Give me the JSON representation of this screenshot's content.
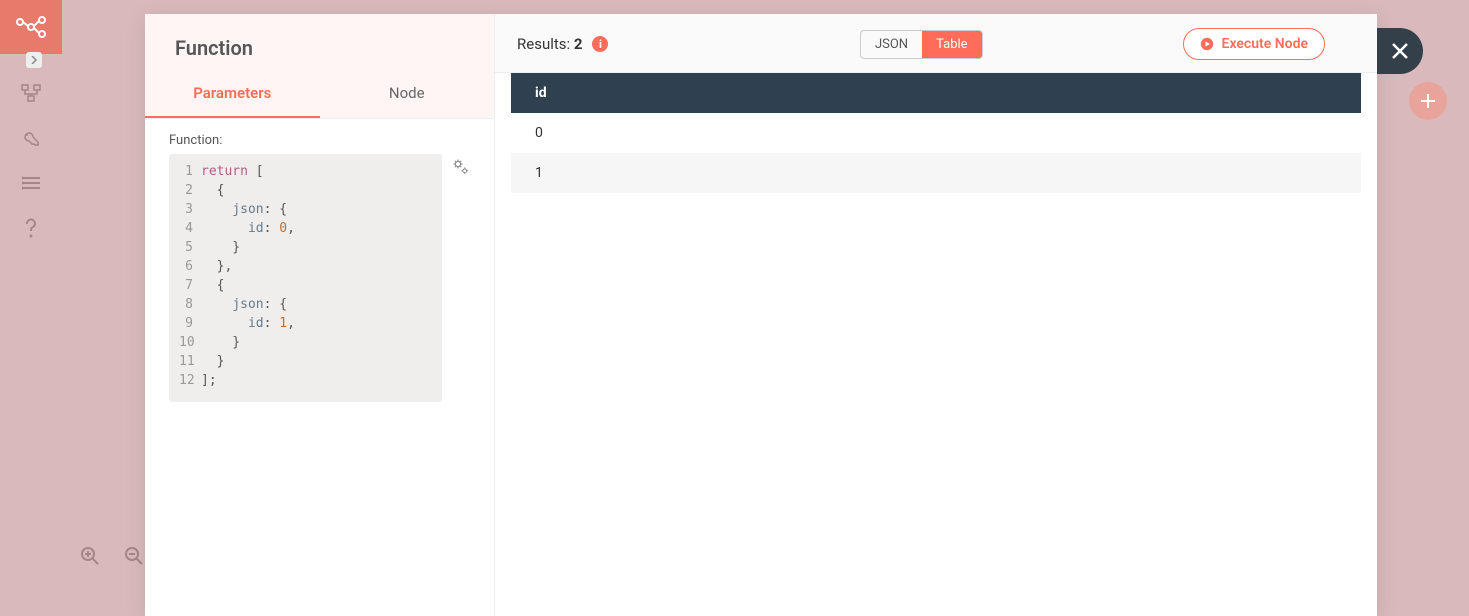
{
  "node_title": "Function",
  "tabs": {
    "parameters": "Parameters",
    "node": "Node",
    "active": "parameters"
  },
  "field_label": "Function:",
  "code": {
    "lines": [
      {
        "n": "1",
        "tokens": [
          {
            "t": "return",
            "c": "key"
          },
          {
            "t": " [",
            "c": "punc"
          }
        ]
      },
      {
        "n": "2",
        "tokens": [
          {
            "t": "  {",
            "c": "punc"
          }
        ]
      },
      {
        "n": "3",
        "tokens": [
          {
            "t": "    ",
            "c": "punc"
          },
          {
            "t": "json",
            "c": "prop"
          },
          {
            "t": ": {",
            "c": "punc"
          }
        ]
      },
      {
        "n": "4",
        "tokens": [
          {
            "t": "      ",
            "c": "punc"
          },
          {
            "t": "id",
            "c": "prop"
          },
          {
            "t": ": ",
            "c": "punc"
          },
          {
            "t": "0",
            "c": "num"
          },
          {
            "t": ",",
            "c": "punc"
          }
        ]
      },
      {
        "n": "5",
        "tokens": [
          {
            "t": "    }",
            "c": "punc"
          }
        ]
      },
      {
        "n": "6",
        "tokens": [
          {
            "t": "  },",
            "c": "punc"
          }
        ]
      },
      {
        "n": "7",
        "tokens": [
          {
            "t": "  {",
            "c": "punc"
          }
        ]
      },
      {
        "n": "8",
        "tokens": [
          {
            "t": "    ",
            "c": "punc"
          },
          {
            "t": "json",
            "c": "prop"
          },
          {
            "t": ": {",
            "c": "punc"
          }
        ]
      },
      {
        "n": "9",
        "tokens": [
          {
            "t": "      ",
            "c": "punc"
          },
          {
            "t": "id",
            "c": "prop"
          },
          {
            "t": ": ",
            "c": "punc"
          },
          {
            "t": "1",
            "c": "num"
          },
          {
            "t": ",",
            "c": "punc"
          }
        ]
      },
      {
        "n": "10",
        "tokens": [
          {
            "t": "    }",
            "c": "punc"
          }
        ]
      },
      {
        "n": "11",
        "tokens": [
          {
            "t": "  }",
            "c": "punc"
          }
        ]
      },
      {
        "n": "12",
        "tokens": [
          {
            "t": "];",
            "c": "punc"
          }
        ]
      }
    ]
  },
  "results": {
    "label": "Results: ",
    "count": "2"
  },
  "view_toggle": {
    "json": "JSON",
    "table": "Table",
    "active": "table"
  },
  "execute_label": "Execute Node",
  "table": {
    "header": "id",
    "rows": [
      "0",
      "1"
    ]
  },
  "colors": {
    "accent": "#ff6d5a",
    "panel_bg": "#fff5f4",
    "dark": "#2f4050"
  }
}
